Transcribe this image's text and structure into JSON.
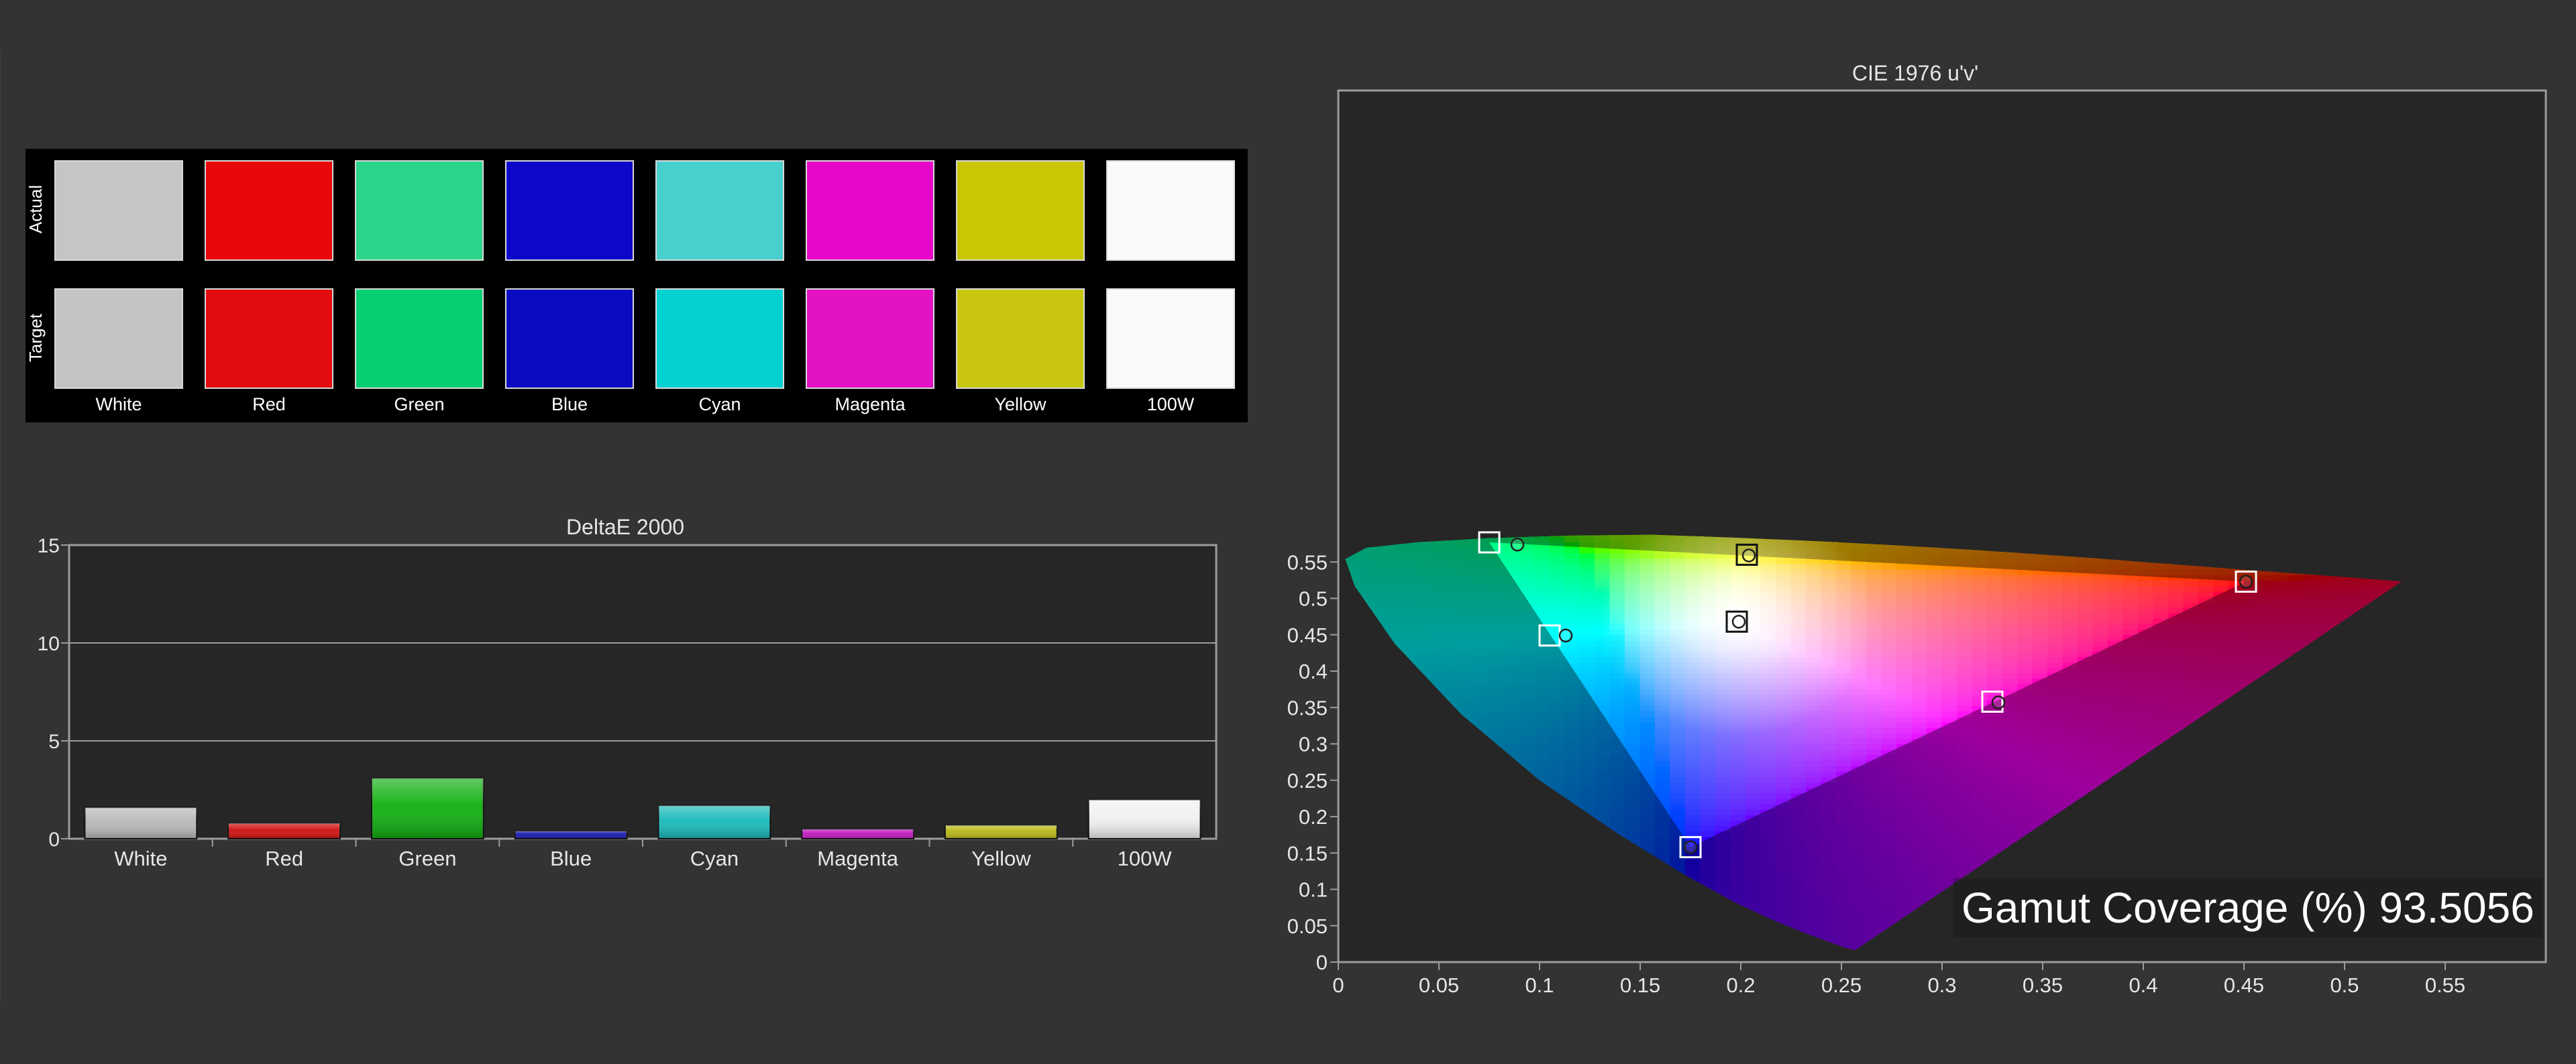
{
  "swatches": {
    "row_labels": [
      "Actual",
      "Target"
    ],
    "patches": [
      {
        "name": "White",
        "actual": "#c6c4c5",
        "target": "#c4c4c4"
      },
      {
        "name": "Red",
        "actual": "#e8080b",
        "target": "#e30c0e"
      },
      {
        "name": "Green",
        "actual": "#2cd58b",
        "target": "#05cf73"
      },
      {
        "name": "Blue",
        "actual": "#0e08c9",
        "target": "#0b0cc1"
      },
      {
        "name": "Cyan",
        "actual": "#48d0cf",
        "target": "#05d1d1"
      },
      {
        "name": "Magenta",
        "actual": "#e707c8",
        "target": "#e312c5"
      },
      {
        "name": "Yellow",
        "actual": "#cac606",
        "target": "#c9c60f"
      },
      {
        "name": "100W",
        "actual": "#fafafa",
        "target": "#fafafa"
      }
    ]
  },
  "chart_data": [
    {
      "type": "bar",
      "title": "DeltaE 2000",
      "categories": [
        "White",
        "Red",
        "Green",
        "Blue",
        "Cyan",
        "Magenta",
        "Yellow",
        "100W"
      ],
      "values": [
        1.6,
        0.8,
        3.1,
        0.4,
        1.7,
        0.5,
        0.7,
        2.0
      ],
      "colors": [
        "#b8b8b8",
        "#d01010",
        "#10b010",
        "#1818b0",
        "#18b8b8",
        "#c018c0",
        "#b8b818",
        "#f0f0f0"
      ],
      "ylim": [
        0,
        15
      ],
      "yticks": [
        0,
        5,
        10,
        15
      ],
      "grid": true
    },
    {
      "type": "scatter",
      "title": "CIE 1976 u'v'",
      "xlim": [
        0,
        0.6
      ],
      "ylim": [
        0,
        0.6
      ],
      "xticks": [
        0,
        0.05,
        0.1,
        0.15,
        0.2,
        0.25,
        0.3,
        0.35,
        0.4,
        0.45,
        0.5,
        0.55
      ],
      "yticks": [
        0,
        0.05,
        0.1,
        0.15,
        0.2,
        0.25,
        0.3,
        0.35,
        0.4,
        0.45,
        0.5,
        0.55
      ],
      "target_gamut": [
        [
          0.451,
          0.523
        ],
        [
          0.075,
          0.577
        ],
        [
          0.175,
          0.158
        ]
      ],
      "targets": [
        {
          "name": "Red",
          "u": 0.451,
          "v": 0.523
        },
        {
          "name": "Green",
          "u": 0.075,
          "v": 0.577
        },
        {
          "name": "Blue",
          "u": 0.175,
          "v": 0.158
        },
        {
          "name": "Cyan",
          "u": 0.105,
          "v": 0.449
        },
        {
          "name": "Magenta",
          "u": 0.325,
          "v": 0.358
        },
        {
          "name": "Yellow",
          "u": 0.203,
          "v": 0.56
        },
        {
          "name": "White",
          "u": 0.198,
          "v": 0.468
        }
      ],
      "measured": [
        {
          "name": "Red",
          "u": 0.451,
          "v": 0.523
        },
        {
          "name": "Green",
          "u": 0.089,
          "v": 0.574
        },
        {
          "name": "Blue",
          "u": 0.175,
          "v": 0.158
        },
        {
          "name": "Cyan",
          "u": 0.113,
          "v": 0.449
        },
        {
          "name": "Magenta",
          "u": 0.328,
          "v": 0.357
        },
        {
          "name": "Yellow",
          "u": 0.204,
          "v": 0.559
        },
        {
          "name": "White",
          "u": 0.199,
          "v": 0.468
        }
      ],
      "annotation": "Gamut Coverage (%) 93.5056"
    }
  ]
}
